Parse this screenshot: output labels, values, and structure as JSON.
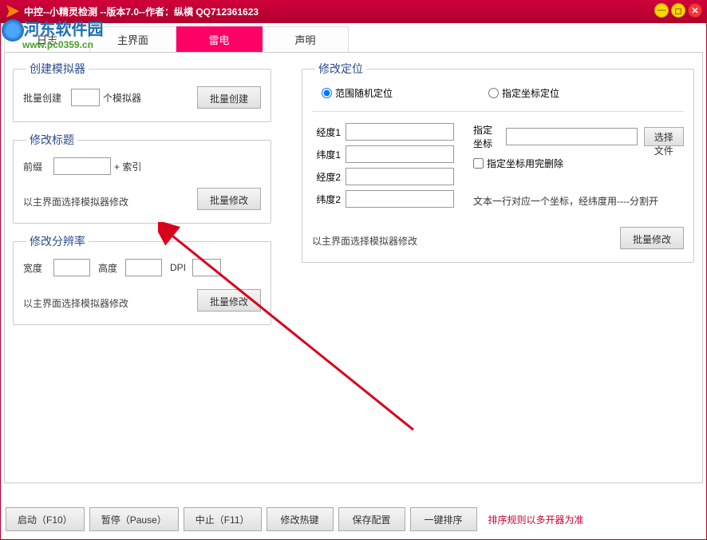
{
  "window": {
    "title": "中控--小精灵检测 --版本7.0--作者：纵横 QQ712361623"
  },
  "watermark": {
    "text": "河东软件园",
    "url": "www.pc0359.cn"
  },
  "tabs": {
    "log": "日志",
    "main": "主界面",
    "leidian": "雷电",
    "shengming": "声明"
  },
  "create_emu": {
    "legend": "创建模拟器",
    "batch_create_label": "批量创建",
    "unit_label": "个模拟器",
    "batch_create_btn": "批量创建"
  },
  "modify_title": {
    "legend": "修改标题",
    "prefix_label": "前缀",
    "suffix_label": "+ 索引",
    "help": "以主界面选择模拟器修改",
    "btn": "批量修改"
  },
  "modify_res": {
    "legend": "修改分辨率",
    "width_label": "宽度",
    "height_label": "高度",
    "dpi_label": "DPI",
    "help": "以主界面选择模拟器修改",
    "btn": "批量修改"
  },
  "modify_loc": {
    "legend": "修改定位",
    "radio_random": "范围随机定位",
    "radio_fixed": "指定坐标定位",
    "lng1": "经度1",
    "lat1": "纬度1",
    "lng2": "经度2",
    "lat2": "纬度2",
    "target_label": "指定坐标",
    "choose_file_btn": "选择文件",
    "chk_delete": "指定坐标用完删除",
    "note": "文本一行对应一个坐标，经纬度用----分割开",
    "help": "以主界面选择模拟器修改",
    "btn": "批量修改"
  },
  "bottom": {
    "start": "启动（F10）",
    "pause": "暂停（Pause）",
    "stop": "中止（F11）",
    "hotkey": "修改热键",
    "save": "保存配置",
    "sort": "一键排序",
    "sort_note": "排序规则以多开器为准"
  }
}
